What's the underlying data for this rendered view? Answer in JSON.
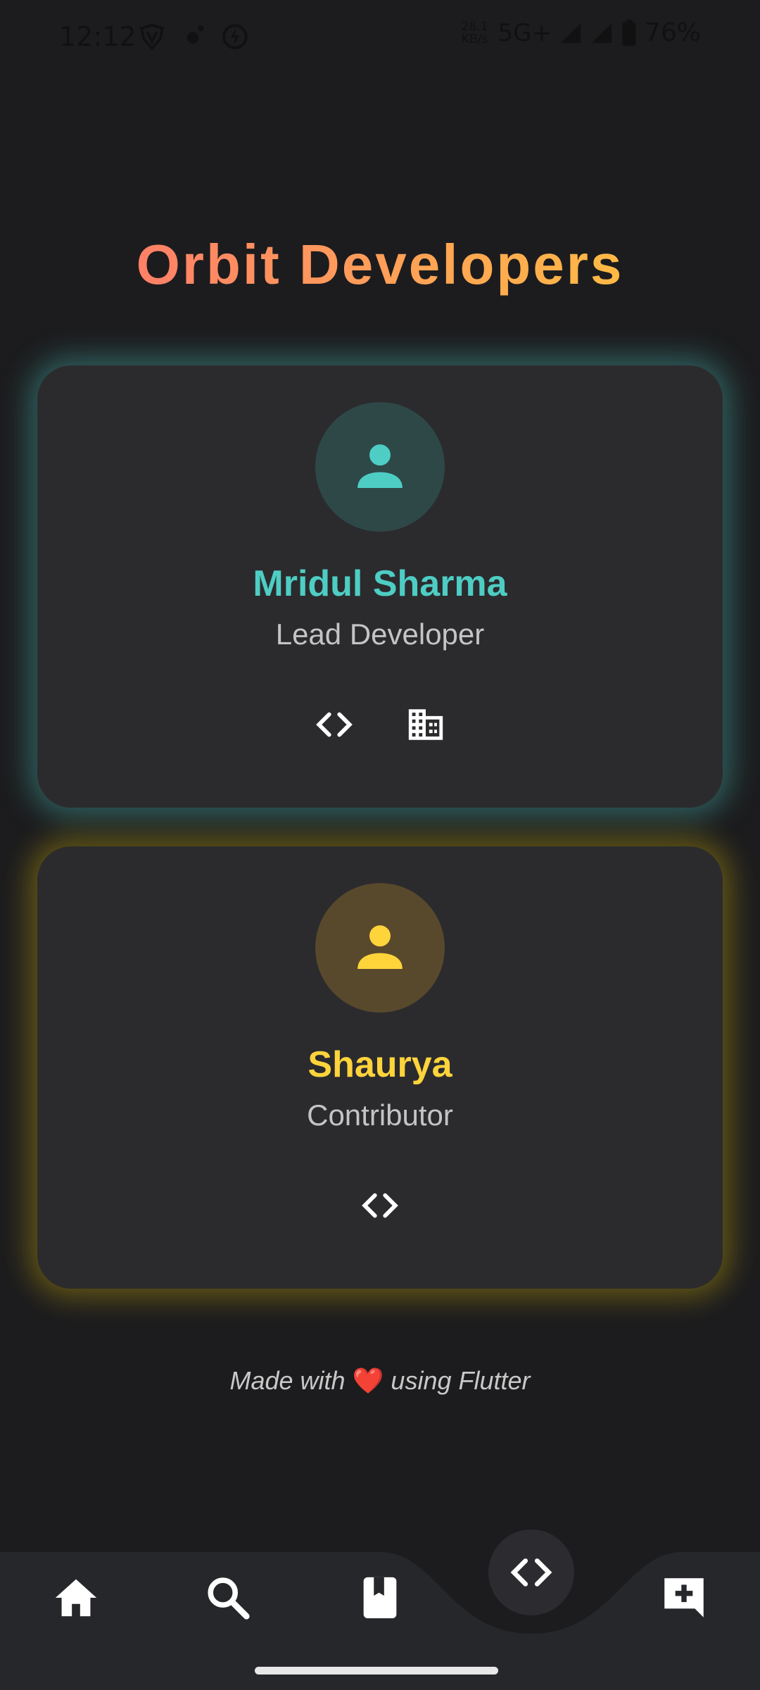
{
  "status_bar": {
    "time": "12:12",
    "net_speed_value": "28.1",
    "net_speed_unit": "KB/s",
    "network": "5G+",
    "battery": "76%"
  },
  "title": "Orbit Developers",
  "developers": [
    {
      "name": "Mridul Sharma",
      "role": "Lead Developer",
      "accent": "#4ecdc4",
      "actions": [
        "code-icon",
        "building-icon"
      ]
    },
    {
      "name": "Shaurya",
      "role": "Contributor",
      "accent": "#ffd43b",
      "actions": [
        "code-icon"
      ]
    }
  ],
  "footer": {
    "prefix": "Made with",
    "heart": "❤️",
    "suffix": "using Flutter"
  },
  "nav": {
    "items": [
      "home-icon",
      "search-icon",
      "book-icon",
      "code-icon",
      "add-comment-icon"
    ],
    "active": "code-icon"
  }
}
